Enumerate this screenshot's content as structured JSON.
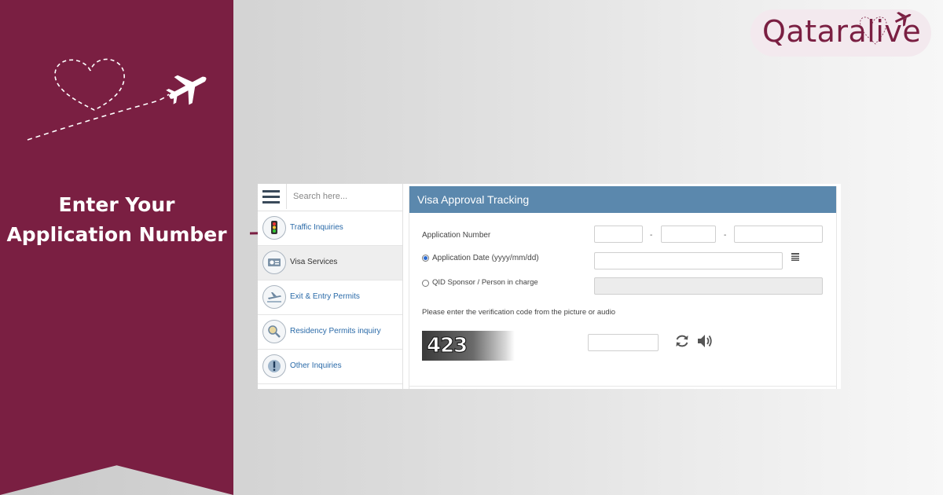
{
  "banner": {
    "title_line1": "Enter Your",
    "title_line2": "Application Number"
  },
  "logo": {
    "text": "Qataralive"
  },
  "sidebar": {
    "search_placeholder": "Search here...",
    "items": [
      {
        "label": "Traffic Inquiries",
        "icon": "traffic-light-icon",
        "active": false
      },
      {
        "label": "Visa Services",
        "icon": "passport-icon",
        "active": true
      },
      {
        "label": "Exit & Entry Permits",
        "icon": "airplane-icon",
        "active": false
      },
      {
        "label": "Residency Permits inquiry",
        "icon": "magnifier-icon",
        "active": false
      },
      {
        "label": "Other Inquiries",
        "icon": "exclamation-icon",
        "active": false
      }
    ]
  },
  "form": {
    "title": "Visa Approval Tracking",
    "application_number_label": "Application Number",
    "separator": "-",
    "application_date_label": "Application Date  (yyyy/mm/dd)",
    "qid_label": "QID Sponsor / Person in charge",
    "verification_prompt": "Please enter the verification code from the picture or audio",
    "captcha_code": "423",
    "selected_option": "application-date"
  },
  "colors": {
    "brand": "#7a1f42",
    "header": "#5b88ad",
    "link": "#2a6aa8"
  }
}
